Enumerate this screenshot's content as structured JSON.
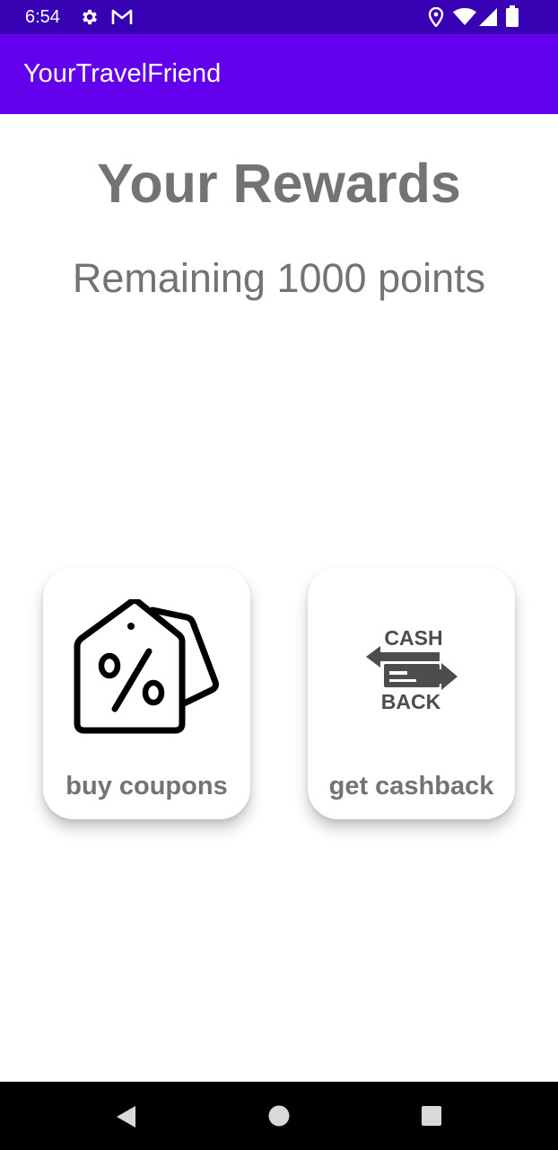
{
  "status_bar": {
    "time": "6:54",
    "left_icons": [
      "gear-icon",
      "gmail-icon"
    ],
    "right_icons": [
      "location-icon",
      "wifi-icon",
      "signal-icon",
      "battery-icon"
    ],
    "background": "#3700b3"
  },
  "app_bar": {
    "title": "YourTravelFriend",
    "background": "#6200ee"
  },
  "main": {
    "title": "Your Rewards",
    "points_text": "Remaining 1000 points",
    "cards": [
      {
        "label": "buy coupons",
        "icon": "discount-tag-icon"
      },
      {
        "label": "get cashback",
        "icon": "cashback-icon",
        "icon_text_top": "CASH",
        "icon_text_bottom": "BACK"
      }
    ]
  },
  "nav_bar": {
    "buttons": [
      "back-icon",
      "home-icon",
      "recents-icon"
    ]
  }
}
